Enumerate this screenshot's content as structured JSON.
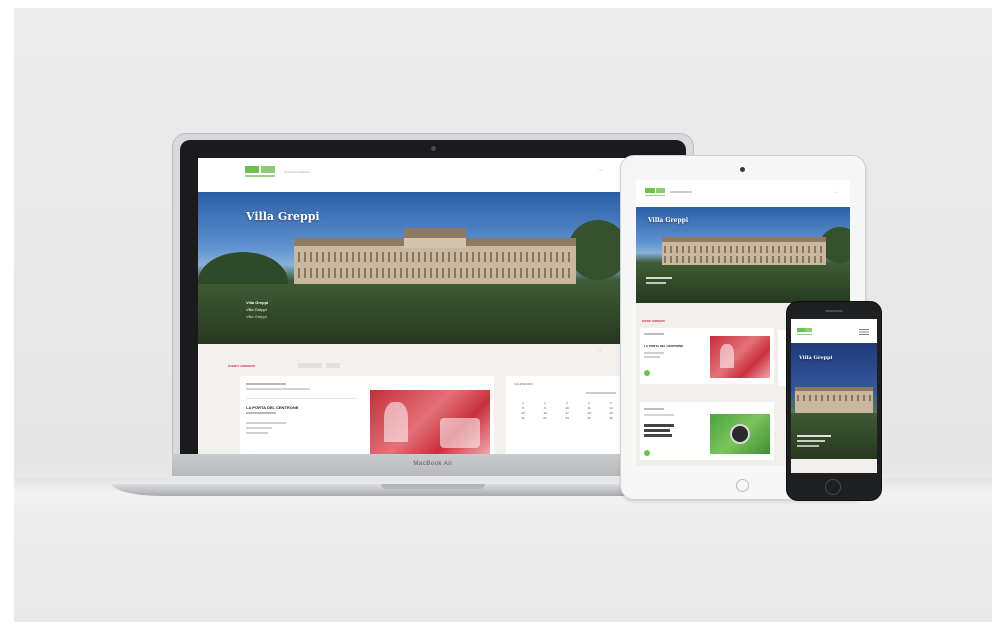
{
  "colors": {
    "brand_green": "#6fbf53",
    "accent_red": "#c8303d",
    "sky_blue": "#3b6fb6"
  },
  "laptop": {
    "brand_label": "MacBook Air",
    "site": {
      "logo_text": "",
      "hero_title": "Villa Greppi",
      "hero_lines": [
        "Villa Greppi",
        "Villa Greppi",
        "Villa Greppi"
      ],
      "section_tabs": [
        "EVENTI CORRENTI",
        "",
        ""
      ],
      "card": {
        "title": "LA PORTA DEL CENTRONE",
        "lines": [
          "",
          "",
          ""
        ]
      },
      "calendar_label": "CALENDARIO",
      "calendar_days": [
        "",
        "",
        "",
        "",
        "",
        "",
        "",
        "1",
        "2",
        "3",
        "4",
        "5",
        "6",
        "7",
        "8",
        "9",
        "10",
        "11",
        "12",
        "13",
        "14",
        "15",
        "16",
        "17",
        "18",
        "19",
        "20",
        "21",
        "22",
        "23",
        "24",
        "25",
        "26",
        "27",
        "28"
      ]
    }
  },
  "tablet": {
    "site": {
      "hero_title": "Villa Greppi",
      "section_tab": "EVENTI CORRENTI",
      "card1_title": "LA PORTA DEL CENTRONE",
      "card2_title": ""
    }
  },
  "phone": {
    "site": {
      "hero_title": "Villa Greppi"
    }
  }
}
